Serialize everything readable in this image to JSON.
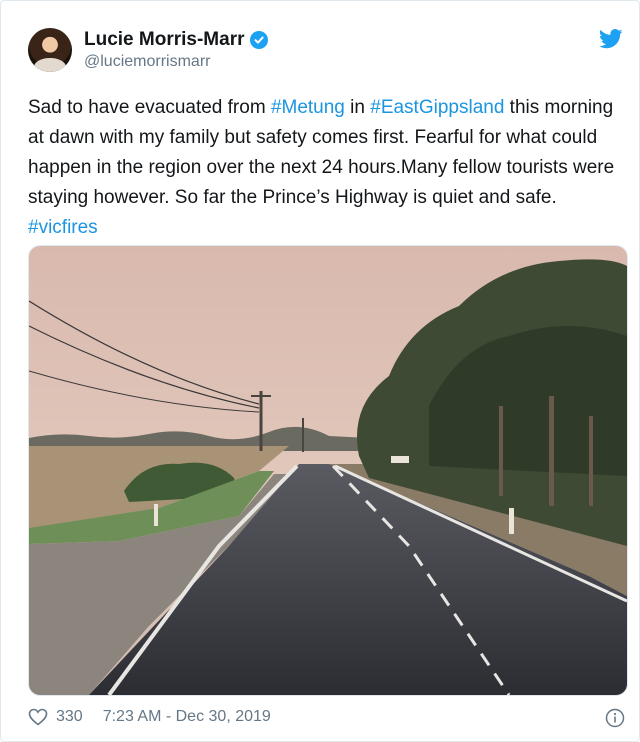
{
  "author": {
    "name": "Lucie Morris-Marr",
    "handle": "@luciemorrismarr",
    "verified": true
  },
  "tweet": {
    "text_1": "Sad to have evacuated from ",
    "tag_1": "#Metung",
    "text_2": " in ",
    "tag_2": "#EastGippsland",
    "text_3": " this morning at dawn with my family but safety comes first. Fearful for what could happen in the region over the next 24 hours.Many fellow tourists were staying however. So far the Prince’s Highway is quiet and safe. ",
    "tag_3": "#vicfires"
  },
  "footer": {
    "likes": "330",
    "timestamp": "7:23 AM - Dec 30, 2019"
  },
  "colors": {
    "link": "#1b95e0",
    "twitter_blue": "#1da1f2",
    "muted": "#657786"
  },
  "icons": {
    "verified": "verified-badge-icon",
    "brand": "twitter-bird-icon",
    "like": "heart-icon",
    "info": "info-icon"
  }
}
